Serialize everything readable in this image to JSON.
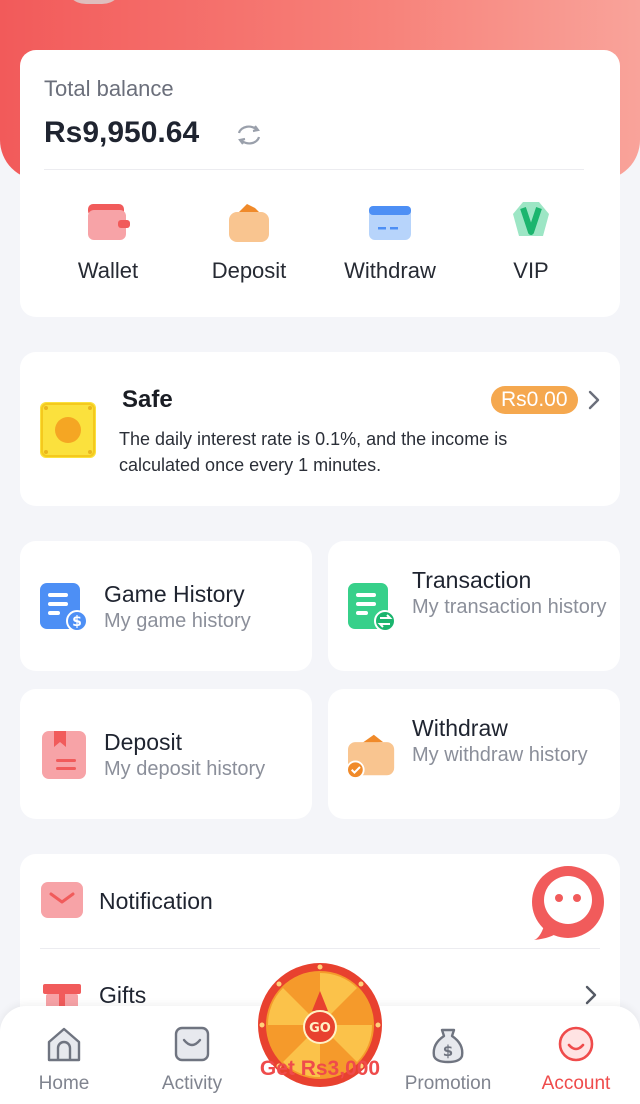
{
  "balance": {
    "label": "Total balance",
    "amount": "Rs9,950.64",
    "actions": [
      {
        "label": "Wallet",
        "icon": "wallet-icon"
      },
      {
        "label": "Deposit",
        "icon": "deposit-icon"
      },
      {
        "label": "Withdraw",
        "icon": "withdraw-icon"
      },
      {
        "label": "VIP",
        "icon": "vip-icon"
      }
    ]
  },
  "safe": {
    "title": "Safe",
    "amount": "Rs0.00",
    "description": "The daily interest rate is 0.1%, and the income is calculated once every 1 minutes."
  },
  "history": [
    {
      "title": "Game History",
      "subtitle": "My game history",
      "icon": "game-history-icon"
    },
    {
      "title": "Transaction",
      "subtitle": "My transaction history",
      "icon": "transaction-icon"
    },
    {
      "title": "Deposit",
      "subtitle": "My deposit history",
      "icon": "deposit-history-icon"
    },
    {
      "title": "Withdraw",
      "subtitle": "My withdraw history",
      "icon": "withdraw-history-icon"
    }
  ],
  "list": {
    "notification": "Notification",
    "gifts": "Gifts"
  },
  "promo": {
    "wheel_text": "GO",
    "label": "Get Rs3,000"
  },
  "nav": [
    {
      "label": "Home",
      "icon": "home-icon"
    },
    {
      "label": "Activity",
      "icon": "activity-icon"
    },
    {
      "label": "Promotion",
      "icon": "promotion-icon"
    },
    {
      "label": "Account",
      "icon": "account-icon",
      "active": true
    }
  ],
  "colors": {
    "brand": "#f25a5a",
    "accent_orange": "#f5a84f",
    "active_nav": "#ef4b4b"
  }
}
